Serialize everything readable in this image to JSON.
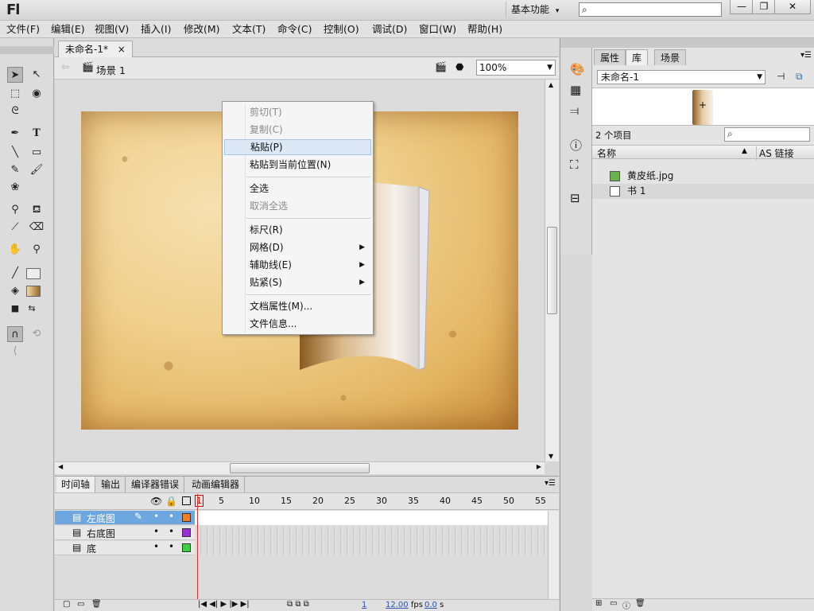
{
  "app": {
    "logo": "Fl",
    "workspace": "基本功能",
    "workspace_caret": "▾"
  },
  "window_controls": {
    "minimize": "—",
    "restore": "❐",
    "close": "✕"
  },
  "menubar": [
    "文件(F)",
    "编辑(E)",
    "视图(V)",
    "插入(I)",
    "修改(M)",
    "文本(T)",
    "命令(C)",
    "控制(O)",
    "调试(D)",
    "窗口(W)",
    "帮助(H)"
  ],
  "document": {
    "tab_label": "未命名-1*",
    "tab_close": "×",
    "scene": "场景 1",
    "zoom": "100%"
  },
  "context_menu": {
    "items": [
      {
        "label": "剪切(T)",
        "enabled": false
      },
      {
        "label": "复制(C)",
        "enabled": false
      },
      {
        "label": "粘贴(P)",
        "enabled": true,
        "highlighted": true
      },
      {
        "label": "粘贴到当前位置(N)",
        "enabled": true
      },
      {
        "label": "全选",
        "enabled": true
      },
      {
        "label": "取消全选",
        "enabled": false
      },
      {
        "label": "标尺(R)",
        "enabled": true
      },
      {
        "label": "网格(D)",
        "enabled": true,
        "submenu": true
      },
      {
        "label": "辅助线(E)",
        "enabled": true,
        "submenu": true
      },
      {
        "label": "贴紧(S)",
        "enabled": true,
        "submenu": true
      },
      {
        "label": "文档属性(M)...",
        "enabled": true
      },
      {
        "label": "文件信息...",
        "enabled": true
      }
    ]
  },
  "timeline": {
    "tabs": [
      "时间轴",
      "输出",
      "编译器错误",
      "动画编辑器"
    ],
    "frame_numbers": [
      "1",
      "5",
      "10",
      "15",
      "20",
      "25",
      "30",
      "35",
      "40",
      "45",
      "50",
      "55"
    ],
    "layers": [
      {
        "name": "左底图",
        "color": "#f07f1e",
        "selected": true
      },
      {
        "name": "右底图",
        "color": "#9b30d0",
        "selected": false
      },
      {
        "name": "底",
        "color": "#3cd03c",
        "selected": false
      }
    ],
    "status": {
      "frame": "1",
      "fps": "12.00",
      "fps_unit": "fps",
      "time": "0.0",
      "time_unit": "s"
    }
  },
  "right_panel": {
    "tabs": [
      "属性",
      "库",
      "场景"
    ],
    "library_doc": "未命名-1",
    "item_count": "2 个项目",
    "columns": {
      "name": "名称",
      "link": "AS 链接"
    },
    "items": [
      {
        "name": "黄皮纸.jpg",
        "icon": "bitmap-icon"
      },
      {
        "name": "书 1",
        "icon": "graphic-symbol-icon"
      }
    ]
  },
  "colors": {
    "accent": "#6ea7e0",
    "stage_base": "#efcf8c",
    "playhead": "#e03030"
  }
}
